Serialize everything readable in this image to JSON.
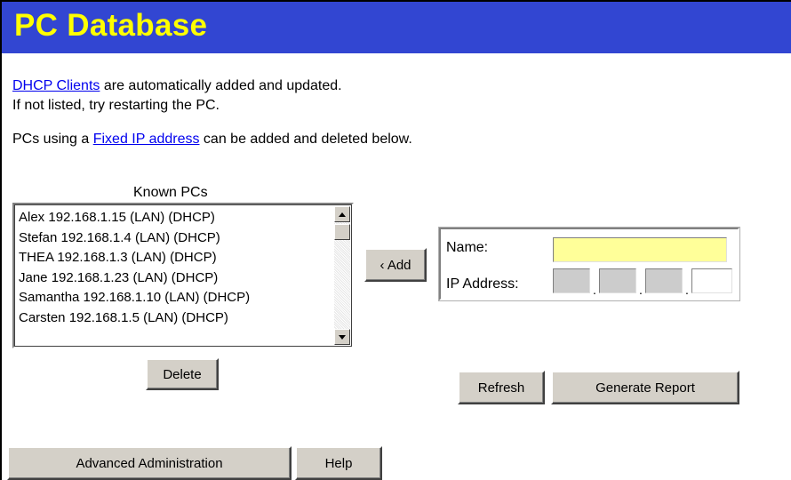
{
  "header": {
    "title": "PC Database"
  },
  "intro": {
    "dhcp_link": "DHCP Clients",
    "dhcp_text": " are automatically added and updated.",
    "line2": "If not listed, try restarting the PC.",
    "fixed_prefix": "PCs using a ",
    "fixed_link": "Fixed IP address",
    "fixed_suffix": " can be added and deleted below."
  },
  "known_pcs": {
    "label": "Known PCs",
    "items": [
      "Alex 192.168.1.15 (LAN) (DHCP)",
      "Stefan 192.168.1.4 (LAN) (DHCP)",
      "THEA 192.168.1.3 (LAN) (DHCP)",
      "Jane 192.168.1.23 (LAN) (DHCP)",
      "Samantha 192.168.1.10 (LAN) (DHCP)",
      "Carsten 192.168.1.5 (LAN) (DHCP)"
    ]
  },
  "buttons": {
    "add": "‹ Add",
    "delete": "Delete",
    "refresh": "Refresh",
    "generate_report": "Generate Report",
    "advanced_admin": "Advanced Administration",
    "help": "Help"
  },
  "form": {
    "name_label": "Name:",
    "name_value": "",
    "ip_label": "IP Address:",
    "ip_octets": [
      "",
      "",
      "",
      ""
    ],
    "ip_dot": "."
  },
  "colors": {
    "header_bg": "#3246d2",
    "header_text": "#ffff00",
    "name_field_bg": "#ffff99",
    "ip_field_disabled_bg": "#cccccc",
    "link": "#0000ee"
  },
  "icons": {
    "scroll_up": "triangle-up-icon",
    "scroll_down": "triangle-down-icon"
  }
}
